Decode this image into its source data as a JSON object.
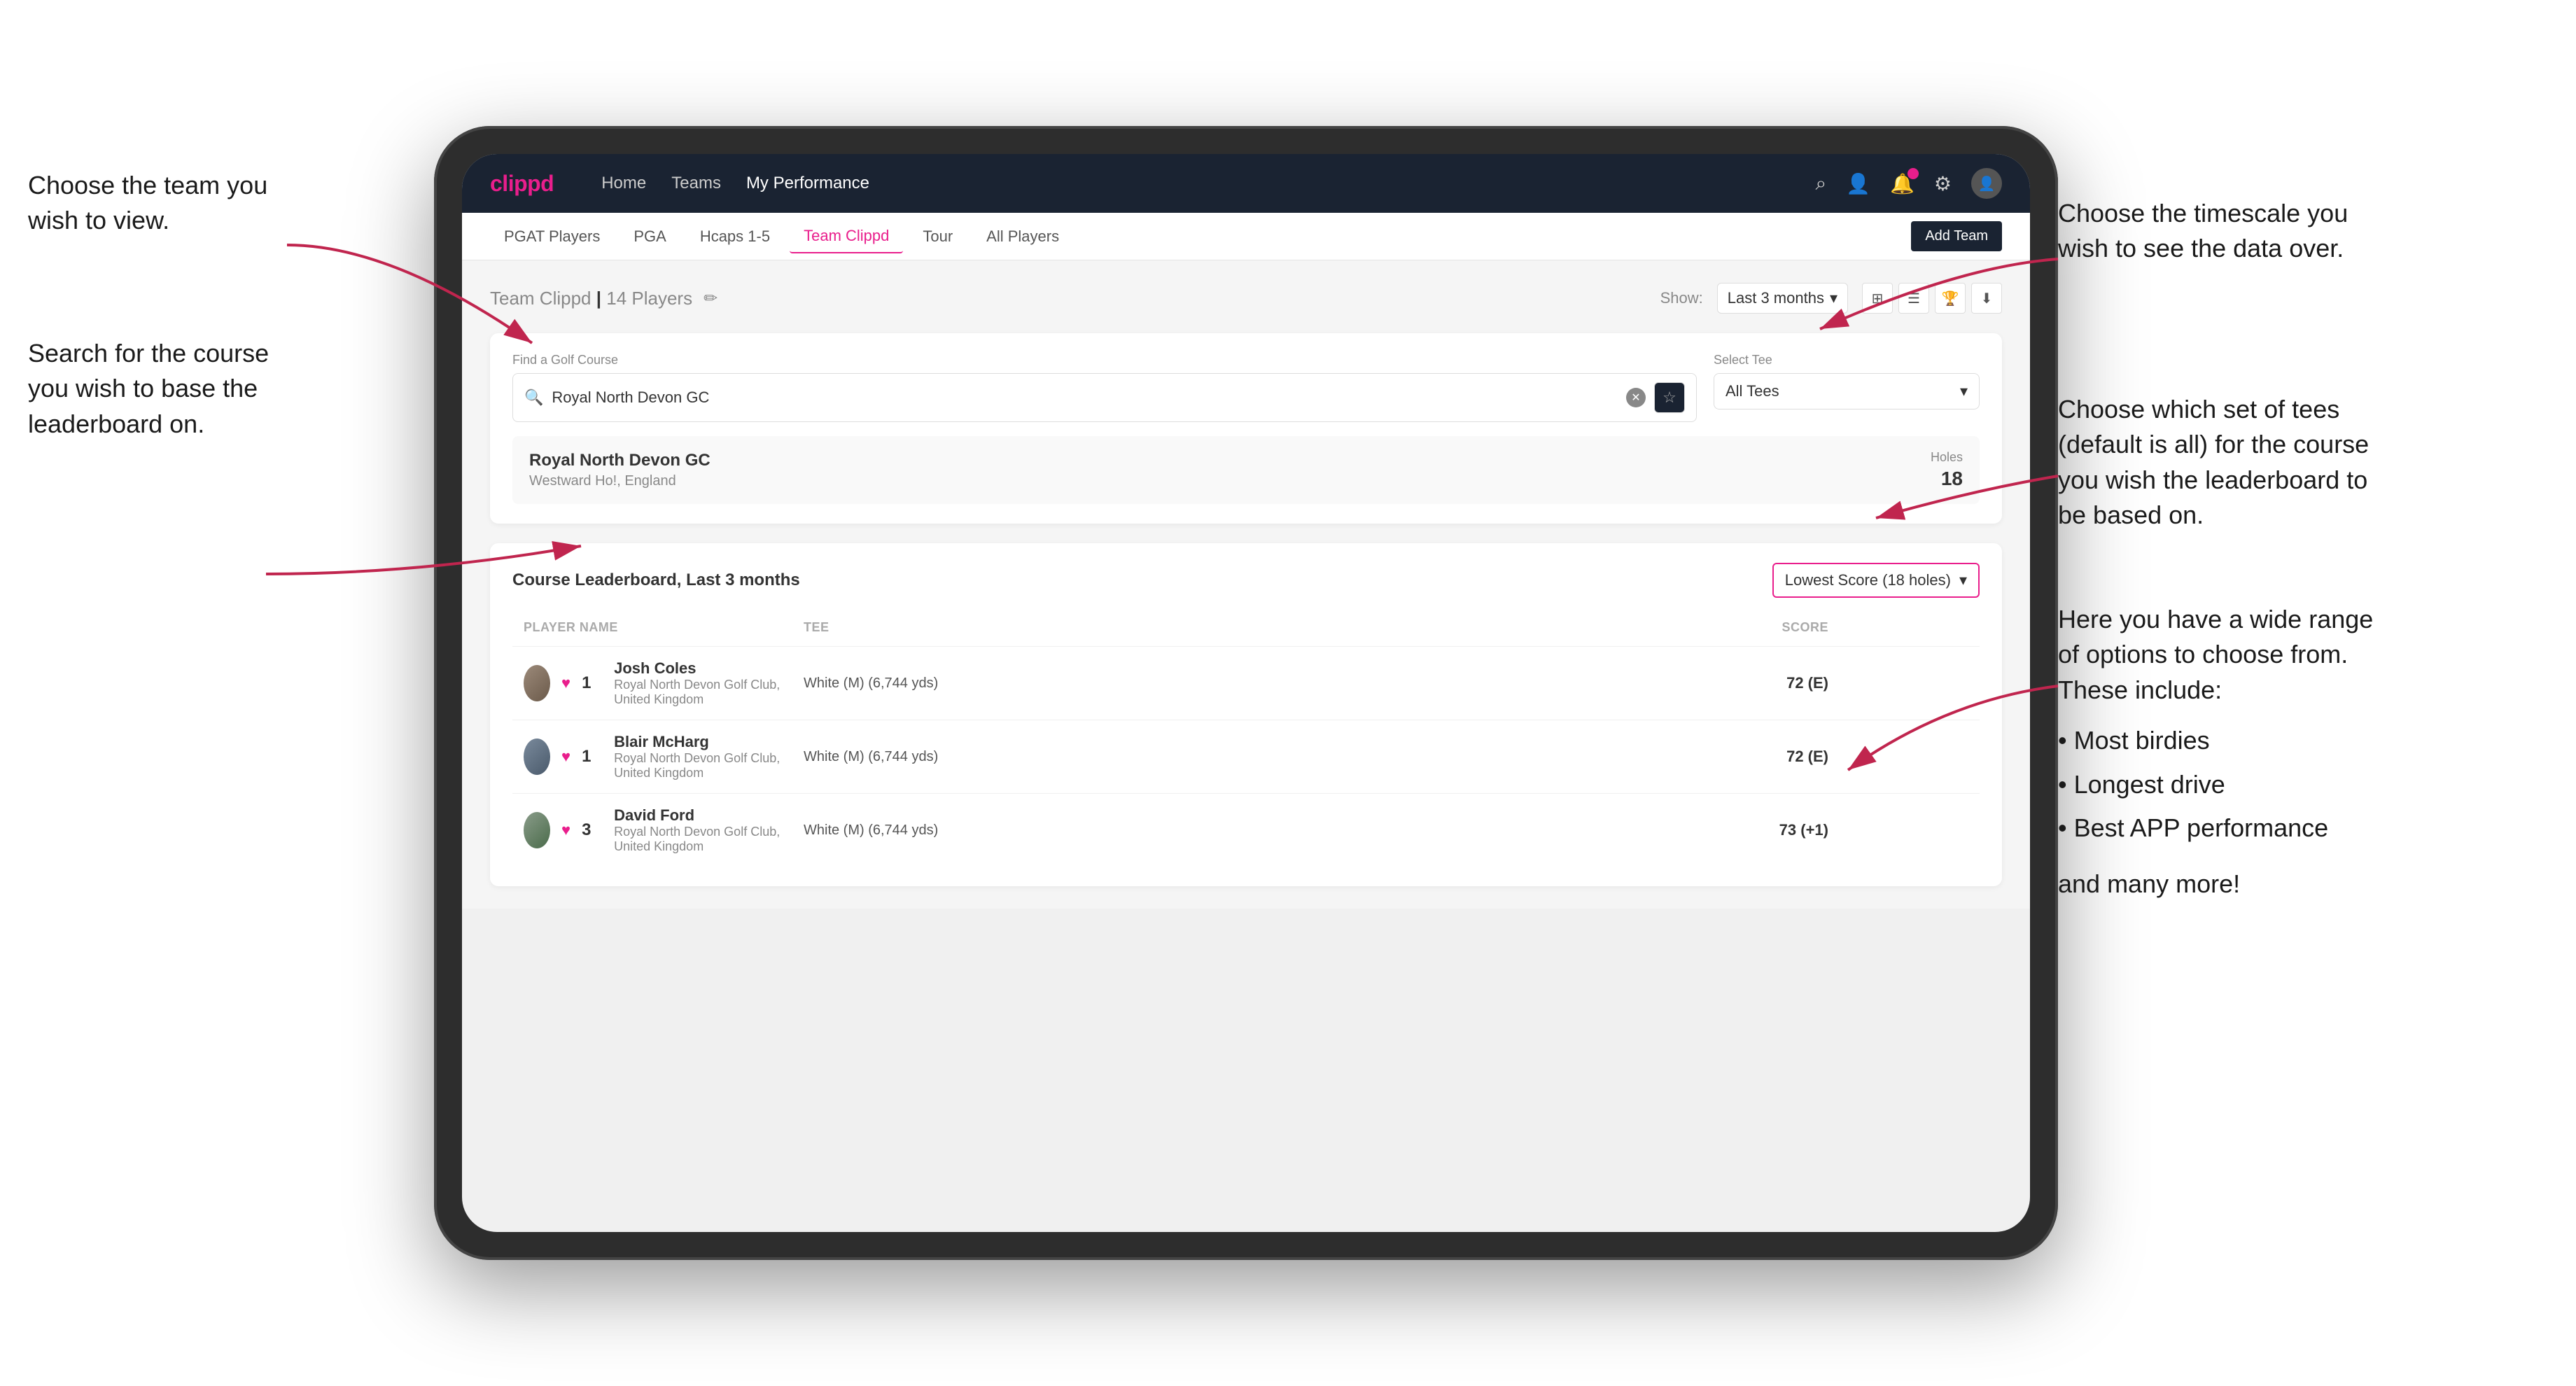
{
  "annotations": {
    "team_label": "Choose the team you\nwish to view.",
    "course_label": "Search for the course\nyou wish to base the\nleaderboard on.",
    "timescale_label": "Choose the timescale you\nwish to see the data over.",
    "tees_label": "Choose which set of tees\n(default is all) for the course\nyou wish the leaderboard to\nbe based on.",
    "options_label": "Here you have a wide range\nof options to choose from.\nThese include:",
    "options_bullets": [
      "Most birdies",
      "Longest drive",
      "Best APP performance"
    ],
    "and_more": "and many more!"
  },
  "nav": {
    "logo": "clippd",
    "links": [
      "Home",
      "Teams",
      "My Performance"
    ],
    "active_link": "My Performance"
  },
  "sub_nav": {
    "items": [
      "PGAT Players",
      "PGA",
      "Hcaps 1-5",
      "Team Clippd",
      "Tour",
      "All Players"
    ],
    "active_item": "Team Clippd",
    "add_team": "Add Team"
  },
  "content_header": {
    "team_name": "Team Clippd",
    "player_count": "14 Players",
    "show_label": "Show:",
    "time_value": "Last 3 months"
  },
  "search": {
    "find_label": "Find a Golf Course",
    "placeholder": "Royal North Devon GC",
    "tee_label": "Select Tee",
    "tee_value": "All Tees"
  },
  "course_result": {
    "name": "Royal North Devon GC",
    "location": "Westward Ho!, England",
    "holes_label": "Holes",
    "holes_value": "18"
  },
  "leaderboard": {
    "title": "Course Leaderboard, Last 3 months",
    "score_type": "Lowest Score (18 holes)",
    "columns": [
      "PLAYER NAME",
      "TEE",
      "SCORE"
    ],
    "rows": [
      {
        "rank": "1",
        "name": "Josh Coles",
        "club": "Royal North Devon Golf Club, United Kingdom",
        "tee": "White (M) (6,744 yds)",
        "score": "72 (E)"
      },
      {
        "rank": "1",
        "name": "Blair McHarg",
        "club": "Royal North Devon Golf Club, United Kingdom",
        "tee": "White (M) (6,744 yds)",
        "score": "72 (E)"
      },
      {
        "rank": "3",
        "name": "David Ford",
        "club": "Royal North Devon Golf Club, United Kingdom",
        "tee": "White (M) (6,744 yds)",
        "score": "73 (+1)"
      }
    ]
  },
  "colors": {
    "brand_pink": "#e91e8c",
    "nav_dark": "#1a2332",
    "text_dark": "#333333",
    "text_muted": "#888888"
  }
}
